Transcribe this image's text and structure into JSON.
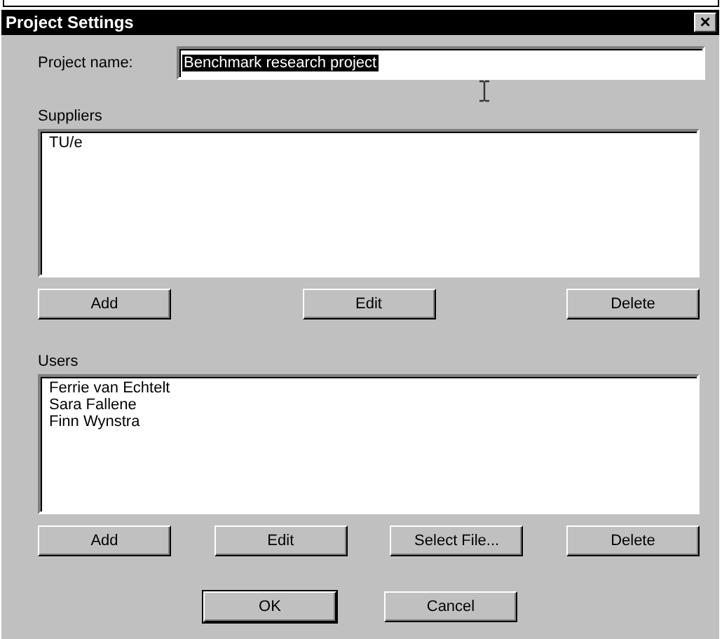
{
  "window": {
    "title": "Project Settings",
    "close": "×"
  },
  "project_name": {
    "label": "Project name:",
    "value": "Benchmark research project",
    "selected": true
  },
  "suppliers": {
    "label": "Suppliers",
    "items": [
      {
        "text": "TU/e"
      }
    ],
    "buttons": [
      {
        "label": "Add"
      },
      {
        "label": "Edit"
      },
      {
        "label": "Delete"
      }
    ]
  },
  "users": {
    "label": "Users",
    "items": [
      {
        "text": "Ferrie van Echtelt"
      },
      {
        "text": "Sara Fallene"
      },
      {
        "text": "Finn Wynstra"
      }
    ],
    "buttons": [
      {
        "label": "Add"
      },
      {
        "label": "Edit"
      },
      {
        "label": "Select File..."
      },
      {
        "label": "Delete"
      }
    ]
  },
  "footer_buttons": [
    {
      "label": "OK",
      "default": true
    },
    {
      "label": "Cancel",
      "default": false
    }
  ]
}
